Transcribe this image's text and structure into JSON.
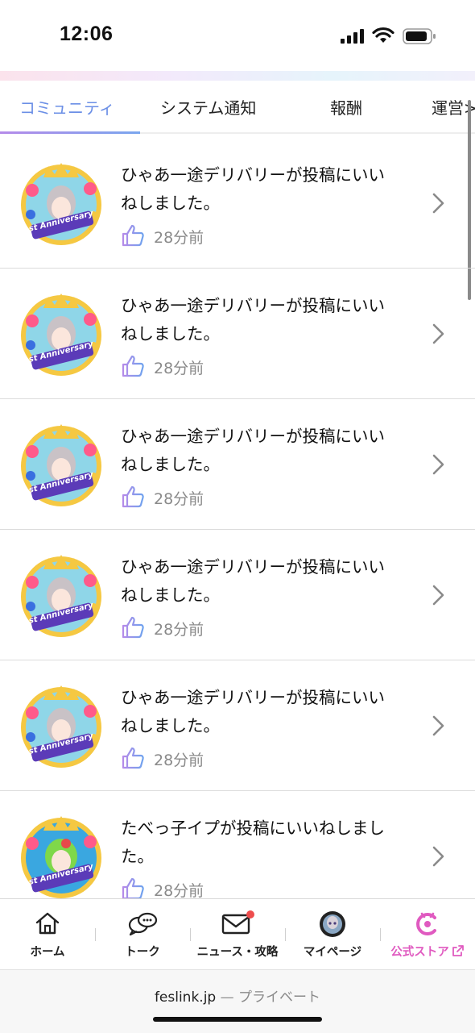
{
  "status_bar": {
    "time": "12:06"
  },
  "tabs": [
    {
      "label": "コミュニティ",
      "active": true
    },
    {
      "label": "システム通知",
      "active": false
    },
    {
      "label": "報酬",
      "active": false
    },
    {
      "label": "運営>",
      "active": false
    }
  ],
  "notifications": [
    {
      "line1": "ひゃあ一途デリバリーが投稿にいい",
      "line2": "ねしました。",
      "time": "28分前",
      "badge": "1st Anniversary"
    },
    {
      "line1": "ひゃあ一途デリバリーが投稿にいい",
      "line2": "ねしました。",
      "time": "28分前",
      "badge": "1st Anniversary"
    },
    {
      "line1": "ひゃあ一途デリバリーが投稿にいい",
      "line2": "ねしました。",
      "time": "28分前",
      "badge": "1st Anniversary"
    },
    {
      "line1": "ひゃあ一途デリバリーが投稿にいい",
      "line2": "ねしました。",
      "time": "28分前",
      "badge": "1st Anniversary"
    },
    {
      "line1": "ひゃあ一途デリバリーが投稿にいい",
      "line2": "ねしました。",
      "time": "28分前",
      "badge": "1st Anniversary"
    },
    {
      "line1": "たべっ子イプが投稿にいいねしまし",
      "line2": "た。",
      "time": "28分前",
      "badge": "1st Anniversary"
    }
  ],
  "bottom_nav": [
    {
      "label": "ホーム",
      "icon": "home-icon"
    },
    {
      "label": "トーク",
      "icon": "chat-icon"
    },
    {
      "label": "ニュース・攻略",
      "icon": "mail-icon",
      "badge_dot": true
    },
    {
      "label": "マイページ",
      "icon": "profile-avatar-icon"
    },
    {
      "label": "公式ストア",
      "icon": "store-icon",
      "external": true
    }
  ],
  "browser": {
    "domain": "feslink.jp",
    "mode": "— プライベート"
  },
  "colors": {
    "accent_blue": "#6b8fe6",
    "accent_purple": "#b58be9",
    "store_pink": "#e05ac0",
    "dot_red": "#ee4d4d"
  }
}
